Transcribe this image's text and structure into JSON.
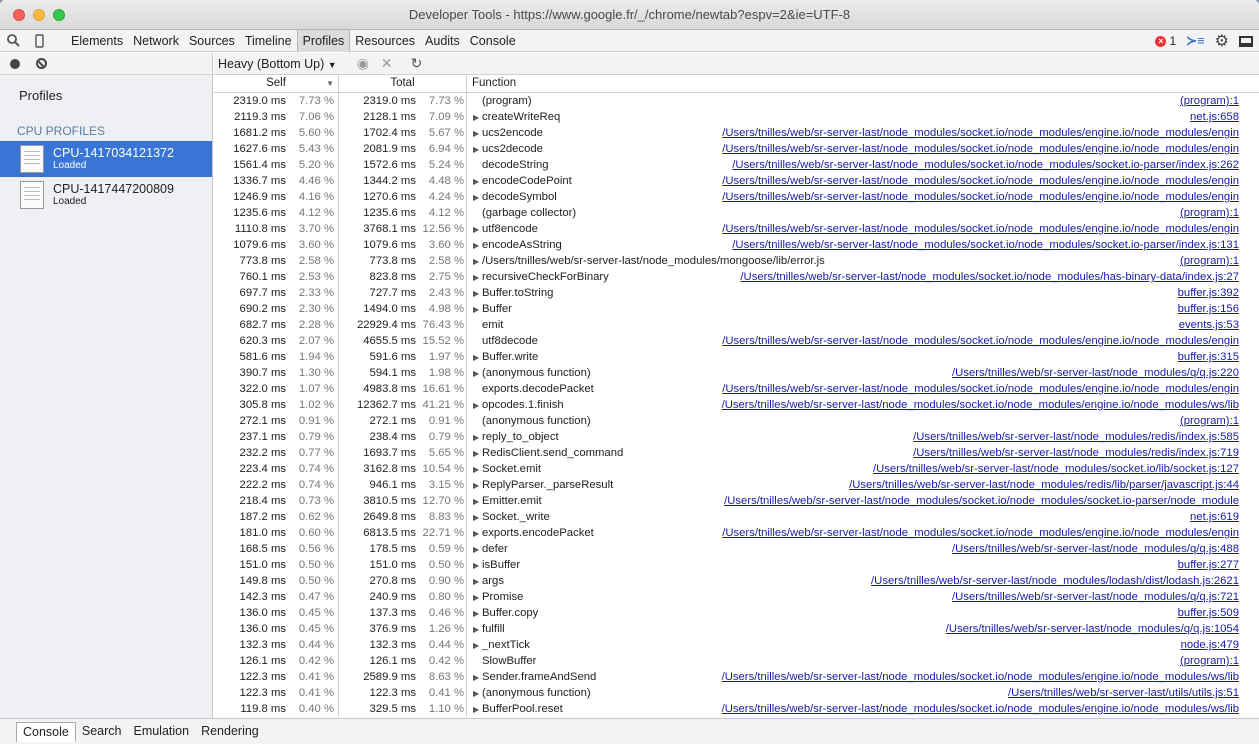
{
  "window": {
    "title": "Developer Tools - https://www.google.fr/_/chrome/newtab?espv=2&ie=UTF-8"
  },
  "toolbar": {
    "tabs": [
      "Elements",
      "Network",
      "Sources",
      "Timeline",
      "Profiles",
      "Resources",
      "Audits",
      "Console"
    ],
    "selected": "Profiles",
    "error_count": "1"
  },
  "sidebar": {
    "title": "Profiles",
    "section": "CPU PROFILES",
    "profiles": [
      {
        "name": "CPU-1417034121372",
        "status": "Loaded"
      },
      {
        "name": "CPU-1417447200809",
        "status": "Loaded"
      }
    ]
  },
  "main": {
    "view_select": "Heavy (Bottom Up)",
    "columns": {
      "self": "Self",
      "total": "Total",
      "function": "Function"
    }
  },
  "rows": [
    [
      "2319.0 ms",
      "7.73 %",
      "2319.0 ms",
      "7.73 %",
      "(program)",
      "(program):1",
      0
    ],
    [
      "2119.3 ms",
      "7.06 %",
      "2128.1 ms",
      "7.09 %",
      "createWriteReq",
      "net.js:658",
      1
    ],
    [
      "1681.2 ms",
      "5.60 %",
      "1702.4 ms",
      "5.67 %",
      "ucs2encode",
      "/Users/tnilles/web/sr-server-last/node_modules/socket.io/node_modules/engine.io/node_modules/engin",
      1
    ],
    [
      "1627.6 ms",
      "5.43 %",
      "2081.9 ms",
      "6.94 %",
      "ucs2decode",
      "/Users/tnilles/web/sr-server-last/node_modules/socket.io/node_modules/engine.io/node_modules/engin",
      1
    ],
    [
      "1561.4 ms",
      "5.20 %",
      "1572.6 ms",
      "5.24 %",
      "decodeString",
      "/Users/tnilles/web/sr-server-last/node_modules/socket.io/node_modules/socket.io-parser/index.js:262",
      0
    ],
    [
      "1336.7 ms",
      "4.46 %",
      "1344.2 ms",
      "4.48 %",
      "encodeCodePoint",
      "/Users/tnilles/web/sr-server-last/node_modules/socket.io/node_modules/engine.io/node_modules/engin",
      1
    ],
    [
      "1246.9 ms",
      "4.16 %",
      "1270.6 ms",
      "4.24 %",
      "decodeSymbol",
      "/Users/tnilles/web/sr-server-last/node_modules/socket.io/node_modules/engine.io/node_modules/engin",
      1
    ],
    [
      "1235.6 ms",
      "4.12 %",
      "1235.6 ms",
      "4.12 %",
      "(garbage collector)",
      "(program):1",
      0
    ],
    [
      "1110.8 ms",
      "3.70 %",
      "3768.1 ms",
      "12.56 %",
      "utf8encode",
      "/Users/tnilles/web/sr-server-last/node_modules/socket.io/node_modules/engine.io/node_modules/engin",
      1
    ],
    [
      "1079.6 ms",
      "3.60 %",
      "1079.6 ms",
      "3.60 %",
      "encodeAsString",
      "/Users/tnilles/web/sr-server-last/node_modules/socket.io/node_modules/socket.io-parser/index.js:131",
      1
    ],
    [
      "773.8 ms",
      "2.58 %",
      "773.8 ms",
      "2.58 %",
      "/Users/tnilles/web/sr-server-last/node_modules/mongoose/lib/error.js",
      "(program):1",
      1
    ],
    [
      "760.1 ms",
      "2.53 %",
      "823.8 ms",
      "2.75 %",
      "recursiveCheckForBinary",
      "/Users/tnilles/web/sr-server-last/node_modules/socket.io/node_modules/has-binary-data/index.js:27",
      1
    ],
    [
      "697.7 ms",
      "2.33 %",
      "727.7 ms",
      "2.43 %",
      "Buffer.toString",
      "buffer.js:392",
      1
    ],
    [
      "690.2 ms",
      "2.30 %",
      "1494.0 ms",
      "4.98 %",
      "Buffer",
      "buffer.js:156",
      1
    ],
    [
      "682.7 ms",
      "2.28 %",
      "22929.4 ms",
      "76.43 %",
      "emit",
      "events.js:53",
      0
    ],
    [
      "620.3 ms",
      "2.07 %",
      "4655.5 ms",
      "15.52 %",
      "utf8decode",
      "/Users/tnilles/web/sr-server-last/node_modules/socket.io/node_modules/engine.io/node_modules/engin",
      0
    ],
    [
      "581.6 ms",
      "1.94 %",
      "591.6 ms",
      "1.97 %",
      "Buffer.write",
      "buffer.js:315",
      1
    ],
    [
      "390.7 ms",
      "1.30 %",
      "594.1 ms",
      "1.98 %",
      "(anonymous function)",
      "/Users/tnilles/web/sr-server-last/node_modules/q/q.js:220",
      1
    ],
    [
      "322.0 ms",
      "1.07 %",
      "4983.8 ms",
      "16.61 %",
      "exports.decodePacket",
      "/Users/tnilles/web/sr-server-last/node_modules/socket.io/node_modules/engine.io/node_modules/engin",
      0
    ],
    [
      "305.8 ms",
      "1.02 %",
      "12362.7 ms",
      "41.21 %",
      "opcodes.1.finish",
      "/Users/tnilles/web/sr-server-last/node_modules/socket.io/node_modules/engine.io/node_modules/ws/lib",
      1
    ],
    [
      "272.1 ms",
      "0.91 %",
      "272.1 ms",
      "0.91 %",
      "(anonymous function)",
      "(program):1",
      0
    ],
    [
      "237.1 ms",
      "0.79 %",
      "238.4 ms",
      "0.79 %",
      "reply_to_object",
      "/Users/tnilles/web/sr-server-last/node_modules/redis/index.js:585",
      1
    ],
    [
      "232.2 ms",
      "0.77 %",
      "1693.7 ms",
      "5.65 %",
      "RedisClient.send_command",
      "/Users/tnilles/web/sr-server-last/node_modules/redis/index.js:719",
      1
    ],
    [
      "223.4 ms",
      "0.74 %",
      "3162.8 ms",
      "10.54 %",
      "Socket.emit",
      "/Users/tnilles/web/sr-server-last/node_modules/socket.io/lib/socket.js:127",
      1
    ],
    [
      "222.2 ms",
      "0.74 %",
      "946.1 ms",
      "3.15 %",
      "ReplyParser._parseResult",
      "/Users/tnilles/web/sr-server-last/node_modules/redis/lib/parser/javascript.js:44",
      1
    ],
    [
      "218.4 ms",
      "0.73 %",
      "3810.5 ms",
      "12.70 %",
      "Emitter.emit",
      "/Users/tnilles/web/sr-server-last/node_modules/socket.io/node_modules/socket.io-parser/node_module",
      1
    ],
    [
      "187.2 ms",
      "0.62 %",
      "2649.8 ms",
      "8.83 %",
      "Socket._write",
      "net.js:619",
      1
    ],
    [
      "181.0 ms",
      "0.60 %",
      "6813.5 ms",
      "22.71 %",
      "exports.encodePacket",
      "/Users/tnilles/web/sr-server-last/node_modules/socket.io/node_modules/engine.io/node_modules/engin",
      1
    ],
    [
      "168.5 ms",
      "0.56 %",
      "178.5 ms",
      "0.59 %",
      "defer",
      "/Users/tnilles/web/sr-server-last/node_modules/q/q.js:488",
      1
    ],
    [
      "151.0 ms",
      "0.50 %",
      "151.0 ms",
      "0.50 %",
      "isBuffer",
      "buffer.js:277",
      1
    ],
    [
      "149.8 ms",
      "0.50 %",
      "270.8 ms",
      "0.90 %",
      "args",
      "/Users/tnilles/web/sr-server-last/node_modules/lodash/dist/lodash.js:2621",
      1
    ],
    [
      "142.3 ms",
      "0.47 %",
      "240.9 ms",
      "0.80 %",
      "Promise",
      "/Users/tnilles/web/sr-server-last/node_modules/q/q.js:721",
      1
    ],
    [
      "136.0 ms",
      "0.45 %",
      "137.3 ms",
      "0.46 %",
      "Buffer.copy",
      "buffer.js:509",
      1
    ],
    [
      "136.0 ms",
      "0.45 %",
      "376.9 ms",
      "1.26 %",
      "fulfill",
      "/Users/tnilles/web/sr-server-last/node_modules/q/q.js:1054",
      1
    ],
    [
      "132.3 ms",
      "0.44 %",
      "132.3 ms",
      "0.44 %",
      "_nextTick",
      "node.js:479",
      1
    ],
    [
      "126.1 ms",
      "0.42 %",
      "126.1 ms",
      "0.42 %",
      "SlowBuffer",
      "(program):1",
      0
    ],
    [
      "122.3 ms",
      "0.41 %",
      "2589.9 ms",
      "8.63 %",
      "Sender.frameAndSend",
      "/Users/tnilles/web/sr-server-last/node_modules/socket.io/node_modules/engine.io/node_modules/ws/lib",
      1
    ],
    [
      "122.3 ms",
      "0.41 %",
      "122.3 ms",
      "0.41 %",
      "(anonymous function)",
      "/Users/tnilles/web/sr-server-last/utils/utils.js:51",
      1
    ],
    [
      "119.8 ms",
      "0.40 %",
      "329.5 ms",
      "1.10 %",
      "BufferPool.reset",
      "/Users/tnilles/web/sr-server-last/node_modules/socket.io/node_modules/engine.io/node_modules/ws/lib",
      1
    ]
  ],
  "drawer": {
    "tabs": [
      "Console",
      "Search",
      "Emulation",
      "Rendering"
    ],
    "selected": "Console"
  },
  "colors": {
    "selection": "#3875d7",
    "link": "#1a1aa6"
  }
}
